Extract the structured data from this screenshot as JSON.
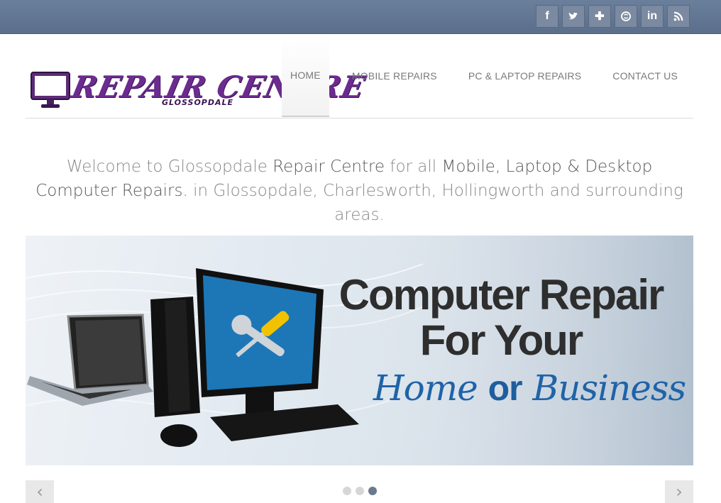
{
  "social": {
    "items": [
      {
        "name": "facebook",
        "glyph": "f"
      },
      {
        "name": "twitter",
        "glyph": ""
      },
      {
        "name": "google-plus",
        "glyph": "✚"
      },
      {
        "name": "skype",
        "glyph": ""
      },
      {
        "name": "linkedin",
        "glyph": "in"
      },
      {
        "name": "rss",
        "glyph": ""
      }
    ]
  },
  "logo": {
    "title": "REPAIR CENTRE",
    "subtitle": "GLOSSOPDALE",
    "brand_color": "#6b2b8f"
  },
  "nav": {
    "items": [
      {
        "label": "HOME",
        "active": true
      },
      {
        "label": "MOBILE REPAIRS",
        "active": false
      },
      {
        "label": "PC & LAPTOP REPAIRS",
        "active": false
      },
      {
        "label": "CONTACT US",
        "active": false
      }
    ]
  },
  "welcome": {
    "p1": "Welcome to Glossopdale ",
    "p2": "Repair Centre",
    "p3": " for all ",
    "p4": "Mobile, Laptop & Desktop Computer Repairs.",
    "p5": " in Glossopdale, Charlesworth, Hollingworth and surrounding areas."
  },
  "slider": {
    "line1": "Computer Repair",
    "line2": "For Your",
    "sub_a": "Home ",
    "sub_or": "or",
    "sub_b": " Business",
    "prev": "‹",
    "next": "›",
    "active_slide": 3,
    "slide_count": 3
  },
  "colors": {
    "topbar": "#5b6f8c",
    "accent_blue": "#1f63a8"
  }
}
